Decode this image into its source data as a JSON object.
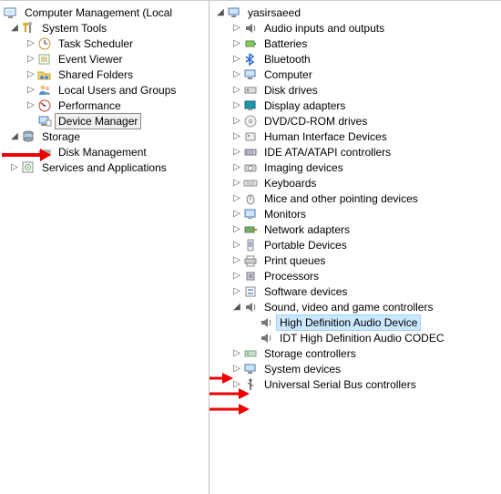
{
  "left_tree": {
    "root_label": "Computer Management (Local",
    "system_tools": {
      "label": "System Tools",
      "children": {
        "task_scheduler": "Task Scheduler",
        "event_viewer": "Event Viewer",
        "shared_folders": "Shared Folders",
        "local_users": "Local Users and Groups",
        "performance": "Performance",
        "device_manager": "Device Manager"
      }
    },
    "storage": {
      "label": "Storage",
      "disk_mgmt": "Disk Management"
    },
    "services_apps": "Services and Applications"
  },
  "right_tree": {
    "root_label": "yasirsaeed",
    "categories": {
      "audio_inputs": "Audio inputs and outputs",
      "batteries": "Batteries",
      "bluetooth": "Bluetooth",
      "computer": "Computer",
      "disk_drives": "Disk drives",
      "display_adapters": "Display adapters",
      "dvd": "DVD/CD-ROM drives",
      "hid": "Human Interface Devices",
      "ide": "IDE ATA/ATAPI controllers",
      "imaging": "Imaging devices",
      "keyboards": "Keyboards",
      "mice": "Mice and other pointing devices",
      "monitors": "Monitors",
      "network": "Network adapters",
      "portable": "Portable Devices",
      "print_queues": "Print queues",
      "processors": "Processors",
      "software_devices": "Software devices",
      "sound": {
        "label": "Sound, video and game controllers",
        "hd_audio": "High Definition Audio Device",
        "idt_codec": "IDT High Definition Audio CODEC"
      },
      "storage_ctrl": "Storage controllers",
      "system_devices": "System devices",
      "usb": "Universal Serial Bus controllers"
    }
  }
}
